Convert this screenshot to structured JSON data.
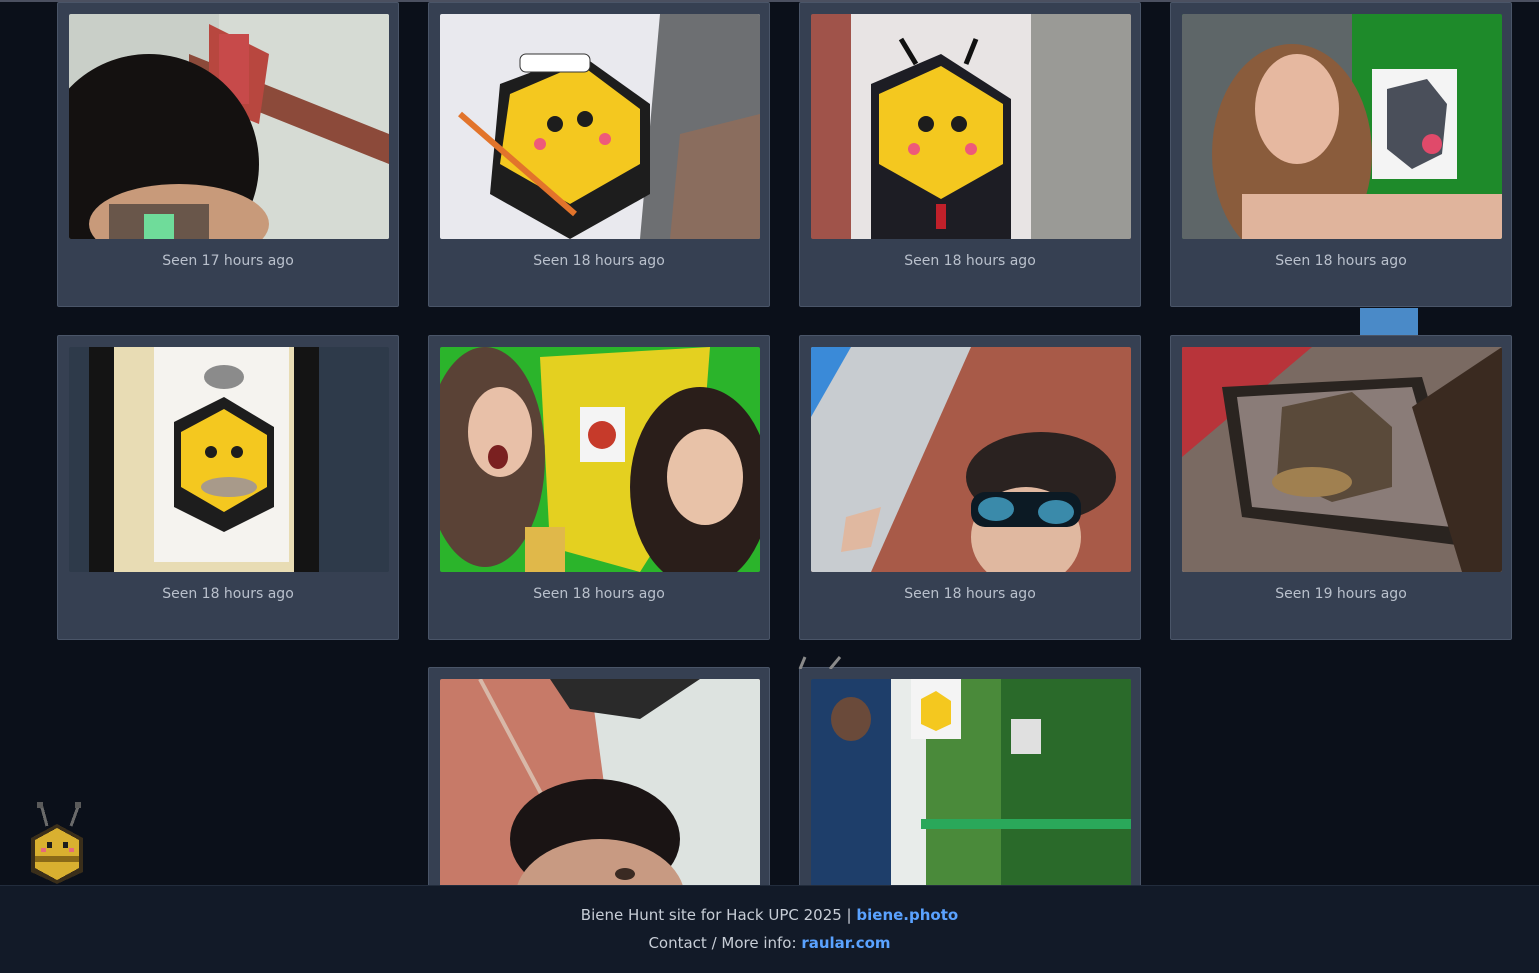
{
  "cards": [
    {
      "caption": "Seen 17 hours ago",
      "image": "curly-hair-selfie-photo"
    },
    {
      "caption": "Seen 18 hours ago",
      "image": "sailor-bee-sticker-photo"
    },
    {
      "caption": "Seen 18 hours ago",
      "image": "suit-bee-sticker-photo"
    },
    {
      "caption": "Seen 18 hours ago",
      "image": "girl-cat-bee-selfie-photo"
    },
    {
      "caption": "Seen 18 hours ago",
      "image": "pigeon-bee-poster-photo"
    },
    {
      "caption": "Seen 18 hours ago",
      "image": "two-girls-bee-selfie-photo"
    },
    {
      "caption": "Seen 18 hours ago",
      "image": "sunglasses-selfie-photo"
    },
    {
      "caption": "Seen 19 hours ago",
      "image": "extintor-bee-sticker-photo"
    },
    {
      "caption": "",
      "image": "man-brick-wall-selfie-photo"
    },
    {
      "caption": "",
      "image": "green-door-bee-sticker-photo"
    }
  ],
  "footer": {
    "line1_text": "Biene Hunt site for Hack UPC 2025 |",
    "line1_link": "biene.photo",
    "line2_text": "Contact / More info:",
    "line2_link": "raular.com"
  },
  "colors": {
    "background": "#0b101a",
    "card": "#364052",
    "link": "#5aa2ff",
    "bee_yellow": "#f4c81f"
  }
}
